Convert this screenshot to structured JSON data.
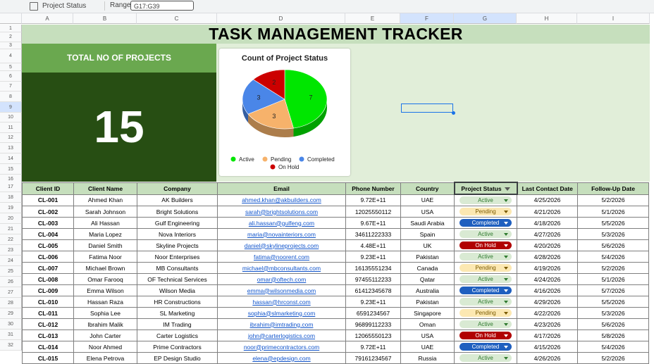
{
  "toolbar": {
    "sheet_name": "Project Status",
    "range_label": "Range:",
    "range_value": "G17:G39"
  },
  "columns": [
    "A",
    "B",
    "C",
    "D",
    "E",
    "F",
    "G",
    "H",
    "I"
  ],
  "rows_top": [
    "1",
    "2",
    "3",
    "4",
    "5",
    "6",
    "7",
    "8",
    "9",
    "10",
    "11",
    "12",
    "13",
    "14",
    "15",
    "16"
  ],
  "title": "TASK MANAGEMENT TRACKER",
  "kpi": {
    "label": "TOTAL NO OF PROJECTS",
    "value": "15"
  },
  "chart_data": {
    "type": "pie",
    "title": "Count of Project Status",
    "slices": [
      {
        "label": "Active",
        "value": 7,
        "color": "#00e600"
      },
      {
        "label": "Pending",
        "value": 3,
        "color": "#f6b26b"
      },
      {
        "label": "Completed",
        "value": 3,
        "color": "#4a86e8"
      },
      {
        "label": "On Hold",
        "value": 2,
        "color": "#cc0000"
      }
    ],
    "legend": "bottom"
  },
  "table": {
    "headers": [
      "Client ID",
      "Client Name",
      "Company",
      "Email",
      "Phone Number",
      "Country",
      "Project Status",
      "Last Contact Date",
      "Follow-Up Date"
    ],
    "status_colors": {
      "Active": {
        "bg": "#d9ead3",
        "fg": "#2f7a2f"
      },
      "Pending": {
        "bg": "#fce8b2",
        "fg": "#7a5a00"
      },
      "Completed": {
        "bg": "#1f5fbf",
        "fg": "#ffffff"
      },
      "On Hold": {
        "bg": "#b10202",
        "fg": "#ffffff"
      }
    },
    "rows": [
      {
        "row": "18",
        "id": "CL-001",
        "name": "Ahmed Khan",
        "company": "AK Builders",
        "email": "ahmed.khan@akbuilders.com",
        "phone": "9.72E+11",
        "country": "UAE",
        "status": "Active",
        "last": "4/25/2026",
        "follow": "5/2/2026"
      },
      {
        "row": "19",
        "id": "CL-002",
        "name": "Sarah Johnson",
        "company": "Bright Solutions",
        "email": "sarah@brightsolutions.com",
        "phone": "12025550112",
        "country": "USA",
        "status": "Pending",
        "last": "4/21/2026",
        "follow": "5/1/2026"
      },
      {
        "row": "20",
        "id": "CL-003",
        "name": "Ali Hassan",
        "company": "Gulf Engineering",
        "email": "ali.hassan@gulfeng.com",
        "phone": "9.67E+11",
        "country": "Saudi Arabia",
        "status": "Completed",
        "last": "4/18/2026",
        "follow": "5/5/2026"
      },
      {
        "row": "21",
        "id": "CL-004",
        "name": "Maria Lopez",
        "company": "Nova Interiors",
        "email": "maria@novainteriors.com",
        "phone": "34611222333",
        "country": "Spain",
        "status": "Active",
        "last": "4/27/2026",
        "follow": "5/3/2026"
      },
      {
        "row": "22",
        "id": "CL-005",
        "name": "Daniel Smith",
        "company": "Skyline Projects",
        "email": "daniel@skylineprojects.com",
        "phone": "4.48E+11",
        "country": "UK",
        "status": "On Hold",
        "last": "4/20/2026",
        "follow": "5/6/2026"
      },
      {
        "row": "23",
        "id": "CL-006",
        "name": "Fatima Noor",
        "company": "Noor Enterprises",
        "email": "fatima@noorent.com",
        "phone": "9.23E+11",
        "country": "Pakistan",
        "status": "Active",
        "last": "4/28/2026",
        "follow": "5/4/2026"
      },
      {
        "row": "24",
        "id": "CL-007",
        "name": "Michael Brown",
        "company": "MB Consultants",
        "email": "michael@mbconsultants.com",
        "phone": "16135551234",
        "country": "Canada",
        "status": "Pending",
        "last": "4/19/2026",
        "follow": "5/2/2026"
      },
      {
        "row": "25",
        "id": "CL-008",
        "name": "Omar Farooq",
        "company": "OF Technical Services",
        "email": "omar@oftech.com",
        "phone": "97455112233",
        "country": "Qatar",
        "status": "Active",
        "last": "4/24/2026",
        "follow": "5/1/2026"
      },
      {
        "row": "26",
        "id": "CL-009",
        "name": "Emma Wilson",
        "company": "Wilson Media",
        "email": "emma@wilsonmedia.com",
        "phone": "61412345678",
        "country": "Australia",
        "status": "Completed",
        "last": "4/16/2026",
        "follow": "5/7/2026"
      },
      {
        "row": "27",
        "id": "CL-010",
        "name": "Hassan Raza",
        "company": "HR Constructions",
        "email": "hassan@hrconst.com",
        "phone": "9.23E+11",
        "country": "Pakistan",
        "status": "Active",
        "last": "4/29/2026",
        "follow": "5/5/2026"
      },
      {
        "row": "28",
        "id": "CL-011",
        "name": "Sophia Lee",
        "company": "SL Marketing",
        "email": "sophia@slmarketing.com",
        "phone": "6591234567",
        "country": "Singapore",
        "status": "Pending",
        "last": "4/22/2026",
        "follow": "5/3/2026"
      },
      {
        "row": "29",
        "id": "CL-012",
        "name": "Ibrahim Malik",
        "company": "IM Trading",
        "email": "ibrahim@imtrading.com",
        "phone": "96899112233",
        "country": "Oman",
        "status": "Active",
        "last": "4/23/2026",
        "follow": "5/6/2026"
      },
      {
        "row": "30",
        "id": "CL-013",
        "name": "John Carter",
        "company": "Carter Logistics",
        "email": "john@carterlogistics.com",
        "phone": "12065550123",
        "country": "USA",
        "status": "On Hold",
        "last": "4/17/2026",
        "follow": "5/8/2026"
      },
      {
        "row": "31",
        "id": "CL-014",
        "name": "Noor Ahmed",
        "company": "Prime Contractors",
        "email": "noor@primecontractors.com",
        "phone": "9.72E+11",
        "country": "UAE",
        "status": "Completed",
        "last": "4/15/2026",
        "follow": "5/4/2026"
      },
      {
        "row": "32",
        "id": "CL-015",
        "name": "Elena Petrova",
        "company": "EP Design Studio",
        "email": "elena@epdesign.com",
        "phone": "79161234567",
        "country": "Russia",
        "status": "Active",
        "last": "4/26/2026",
        "follow": "5/2/2026"
      }
    ]
  }
}
